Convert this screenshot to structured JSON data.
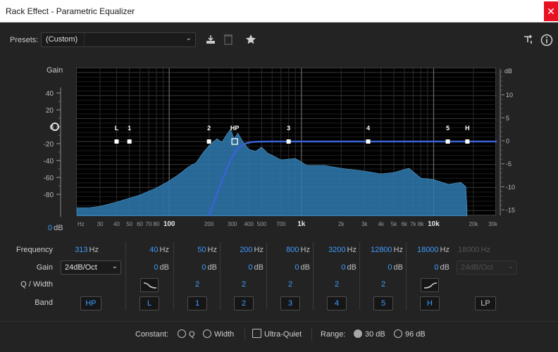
{
  "window": {
    "title": "Rack Effect - Parametric Equalizer",
    "close_icon": "close-icon"
  },
  "toolbar": {
    "presets_label": "Presets:",
    "preset_value": "(Custom)",
    "icons": [
      "download-preset-icon",
      "delete-preset-icon",
      "favorite-star-icon",
      "routing-icon",
      "info-icon"
    ]
  },
  "graph": {
    "gain_title": "Gain",
    "gain_readout_value": "0",
    "gain_readout_unit": "dB",
    "left_axis_ticks": [
      "40",
      "20",
      "0",
      "-20",
      "-40",
      "-60",
      "-80"
    ],
    "right_axis_unit": "dB",
    "right_axis_ticks": [
      "10",
      "5",
      "0",
      "-5",
      "-10",
      "-15"
    ],
    "freq_ticks": [
      "Hz",
      "30",
      "40",
      "50",
      "60",
      "70",
      "80",
      "100",
      "200",
      "300",
      "400",
      "500",
      "700",
      "1k",
      "2k",
      "3k",
      "4k",
      "5k",
      "6k",
      "7k",
      "8k",
      "10k",
      "20k",
      "30k"
    ],
    "node_labels": [
      "L",
      "1",
      "2",
      "HP",
      "3",
      "4",
      "5",
      "H"
    ],
    "colors": {
      "spectrum": "#2f7ab0",
      "curve": "#3a62d6",
      "accent": "#3f9bff"
    }
  },
  "bands": {
    "row_labels": {
      "frequency": "Frequency",
      "gain": "Gain",
      "q_width": "Q / Width",
      "band": "Band"
    },
    "hp": {
      "freq": "313",
      "gain_slope": "24dB/Oct",
      "button": "HP"
    },
    "columns": [
      {
        "freq": "40",
        "gain": "0",
        "q": "",
        "shape": "low-shelf",
        "button": "L"
      },
      {
        "freq": "50",
        "gain": "0",
        "q": "2",
        "shape": "",
        "button": "1"
      },
      {
        "freq": "200",
        "gain": "0",
        "q": "2",
        "shape": "",
        "button": "2"
      },
      {
        "freq": "800",
        "gain": "0",
        "q": "2",
        "shape": "",
        "button": "3"
      },
      {
        "freq": "3200",
        "gain": "0",
        "q": "2",
        "shape": "",
        "button": "4"
      },
      {
        "freq": "12800",
        "gain": "0",
        "q": "2",
        "shape": "",
        "button": "5"
      },
      {
        "freq": "18000",
        "gain": "0",
        "q": "",
        "shape": "high-shelf",
        "button": "H"
      }
    ],
    "lp": {
      "freq": "18000",
      "gain_slope": "24dB/Oct",
      "button": "LP"
    },
    "units": {
      "hz": "Hz",
      "db": "dB"
    }
  },
  "footer": {
    "constant_label": "Constant:",
    "q_label": "Q",
    "width_label": "Width",
    "ultra_quiet_label": "Ultra-Quiet",
    "range_label": "Range:",
    "range_30": "30 dB",
    "range_96": "96 dB"
  }
}
